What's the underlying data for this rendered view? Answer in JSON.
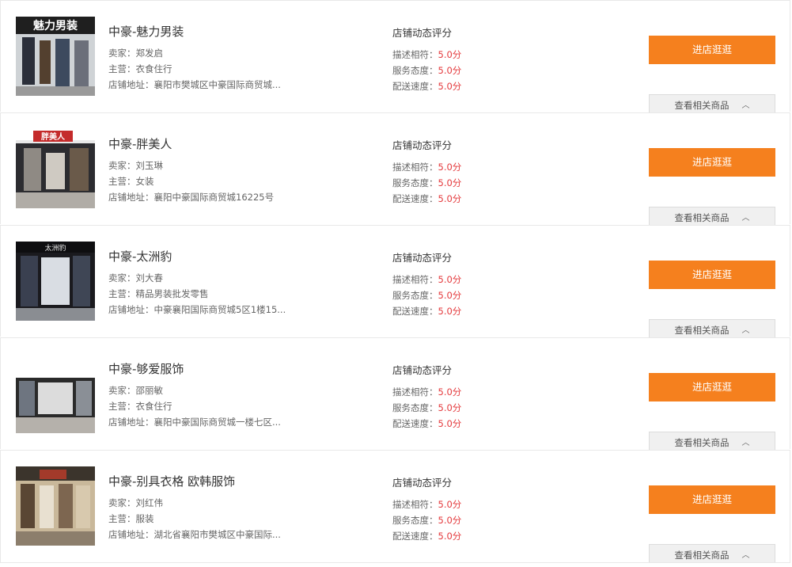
{
  "labels": {
    "seller_prefix": "卖家：",
    "main_prefix": "主营：",
    "addr_prefix": "店铺地址：",
    "rating_title": "店铺动态评分",
    "desc_label": "描述相符：",
    "service_label": "服务态度：",
    "delivery_label": "配送速度：",
    "enter_button": "进店逛逛",
    "related_button": "查看相关商品",
    "chevron": "︿"
  },
  "colors": {
    "accent": "#f5801e",
    "score": "#e4393c"
  },
  "stores": [
    {
      "name": "中豪-魅力男装",
      "seller": "郑发启",
      "main": "衣食住行",
      "address": "襄阳市樊城区中豪国际商贸城...",
      "desc_score": "5.0分",
      "service_score": "5.0分",
      "delivery_score": "5.0分",
      "thumb_sign": "魅力男装"
    },
    {
      "name": "中豪-胖美人",
      "seller": "刘玉琳",
      "main": "女装",
      "address": "襄阳中豪国际商贸城16225号",
      "desc_score": "5.0分",
      "service_score": "5.0分",
      "delivery_score": "5.0分",
      "thumb_sign": "胖美人"
    },
    {
      "name": "中豪-太洲豹",
      "seller": "刘大春",
      "main": "精品男装批发零售",
      "address": "中豪襄阳国际商贸城5区1楼15...",
      "desc_score": "5.0分",
      "service_score": "5.0分",
      "delivery_score": "5.0分",
      "thumb_sign": "太洲豹"
    },
    {
      "name": "中豪-够爱服饰",
      "seller": "邵丽敏",
      "main": "衣食住行",
      "address": "襄阳中豪国际商贸城一楼七区...",
      "desc_score": "5.0分",
      "service_score": "5.0分",
      "delivery_score": "5.0分",
      "thumb_sign": ""
    },
    {
      "name": "中豪-别具衣格 欧韩服饰",
      "seller": "刘红伟",
      "main": "服装",
      "address": "湖北省襄阳市樊城区中豪国际...",
      "desc_score": "5.0分",
      "service_score": "5.0分",
      "delivery_score": "5.0分",
      "thumb_sign": ""
    }
  ]
}
